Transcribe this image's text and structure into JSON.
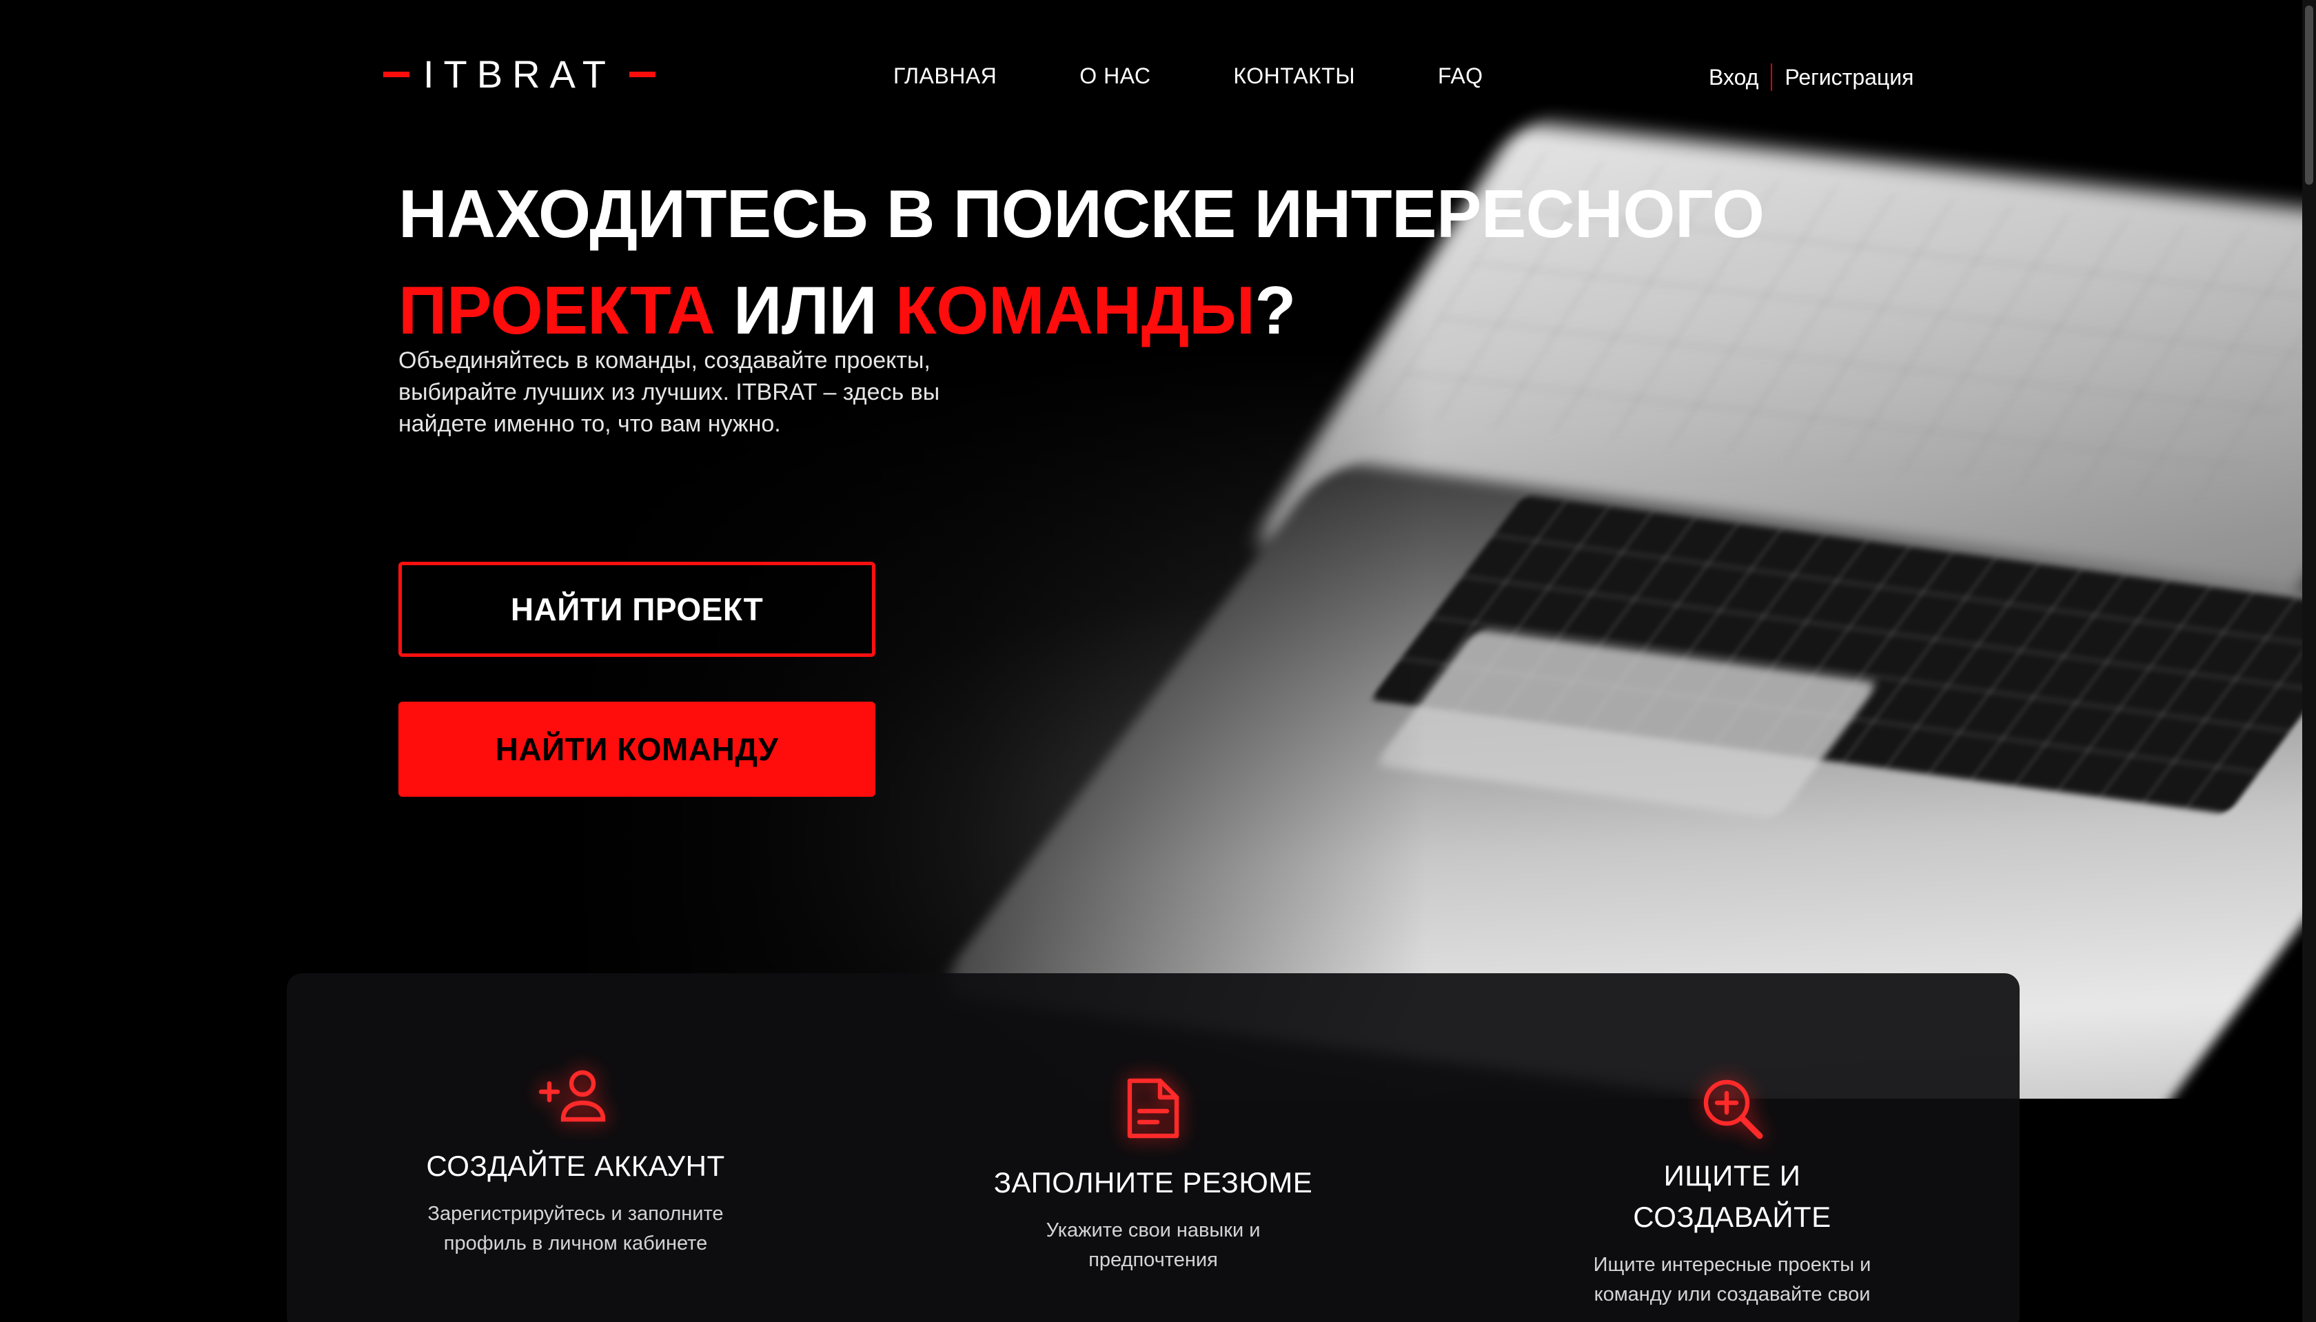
{
  "brand": {
    "logo_text": "ITBRAT",
    "accent_color": "#ff0d0d"
  },
  "nav": {
    "items": [
      {
        "label": "ГЛАВНАЯ"
      },
      {
        "label": "О НАС"
      },
      {
        "label": "КОНТАКТЫ"
      },
      {
        "label": "FAQ"
      }
    ]
  },
  "auth": {
    "login_label": "Вход",
    "register_label": "Регистрация"
  },
  "hero": {
    "headline_line1": "НАХОДИТЕСЬ В ПОИСКЕ ИНТЕРЕСНОГО",
    "headline_word_project": "ПРОЕКТА",
    "headline_or": " ИЛИ ",
    "headline_word_team": "КОМАНДЫ",
    "headline_end": "?",
    "subtext_lines": [
      "Объединяйтесь в команды, создавайте проекты,",
      "выбирайте лучших из лучших. ITBRAT – здесь вы",
      "найдете именно то, что вам нужно."
    ],
    "find_project_label": "НАЙТИ ПРОЕКТ",
    "find_team_label": "НАЙТИ КОМАНДУ"
  },
  "features": [
    {
      "icon": "add-person-icon",
      "title_lines": [
        "СОЗДАЙТЕ АККАУНТ"
      ],
      "desc_lines": [
        "Зарегистрируйтесь и заполните",
        "профиль в личном кабинете"
      ]
    },
    {
      "icon": "document-icon",
      "title_lines": [
        "ЗАПОЛНИТЕ РЕЗЮМЕ"
      ],
      "desc_lines": [
        "Укажите свои навыки и",
        "предпочтения"
      ]
    },
    {
      "icon": "zoom-in-icon",
      "title_lines": [
        "ИЩИТЕ И",
        "СОЗДАВАЙТЕ"
      ],
      "desc_lines": [
        "Ищите интересные проекты и",
        "команду или создавайте свои"
      ]
    }
  ]
}
